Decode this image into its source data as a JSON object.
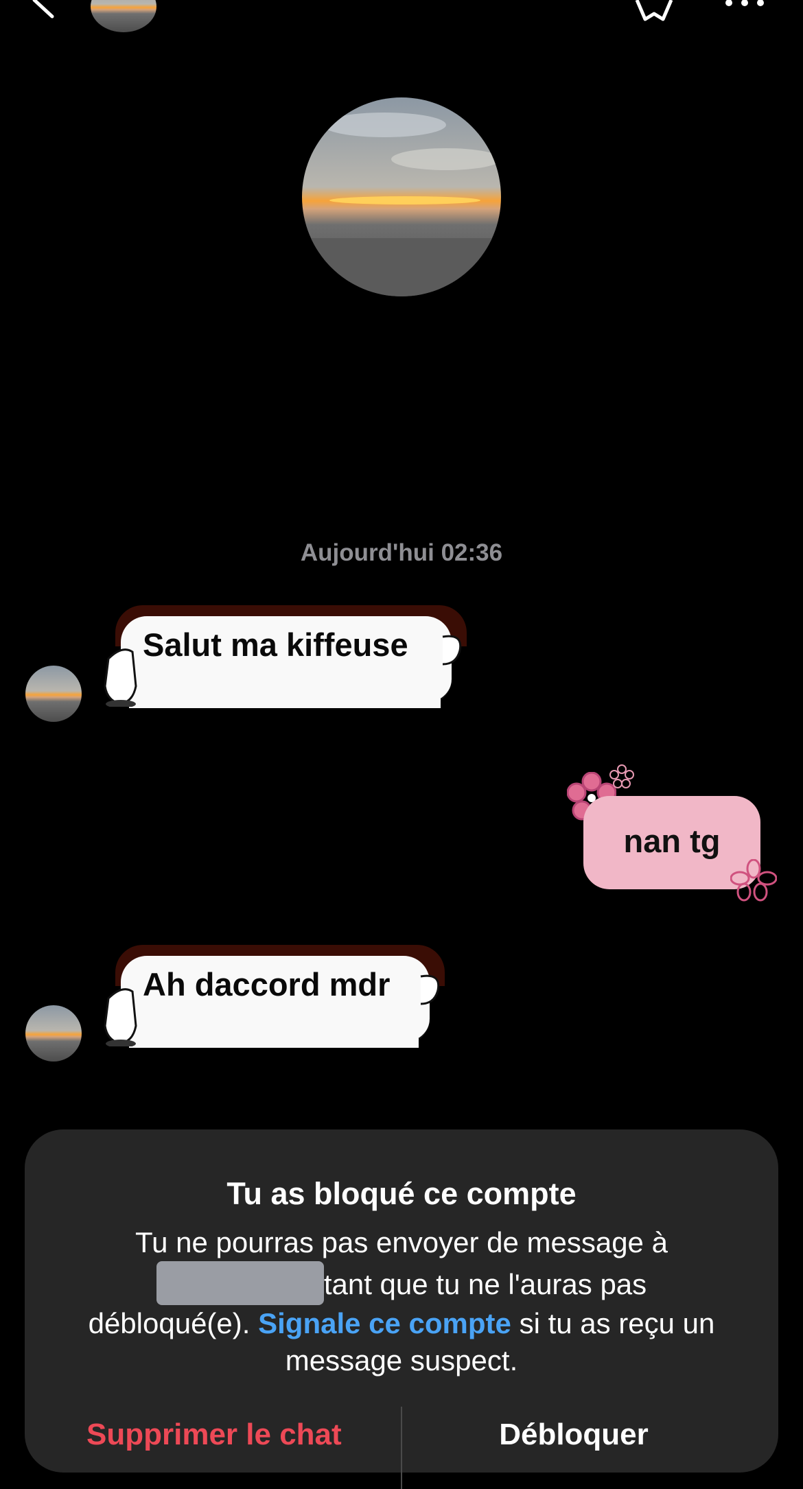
{
  "header": {
    "back_icon": "chevron-left-icon",
    "avatar": "sunset-beach-profile-photo",
    "star_icon": "star-icon",
    "more_icon": "more-horizontal-icon"
  },
  "profile": {
    "avatar": "sunset-beach-profile-photo"
  },
  "conversation": {
    "timestamp": "Aujourd'hui 02:36",
    "messages": [
      {
        "from": "them",
        "text": "Salut ma kiffeuse"
      },
      {
        "from": "me",
        "text": "nan tg"
      },
      {
        "from": "them",
        "text": "Ah daccord mdr"
      }
    ]
  },
  "blocked_panel": {
    "title": "Tu as bloqué ce compte",
    "message_part1": "Tu ne pourras pas envoyer de message à",
    "message_part2": "tant que tu ne l'auras pas débloqué(e).",
    "report_link": "Signale ce compte",
    "message_part3": "si tu as reçu un message suspect.",
    "delete_label": "Supprimer le chat",
    "unblock_label": "Débloquer"
  },
  "colors": {
    "background": "#000000",
    "timestamp": "#8e8e93",
    "outgoing_bubble": "#f1b7c7",
    "link": "#4aa3f5",
    "delete": "#ed4956",
    "panel": "#262626"
  }
}
